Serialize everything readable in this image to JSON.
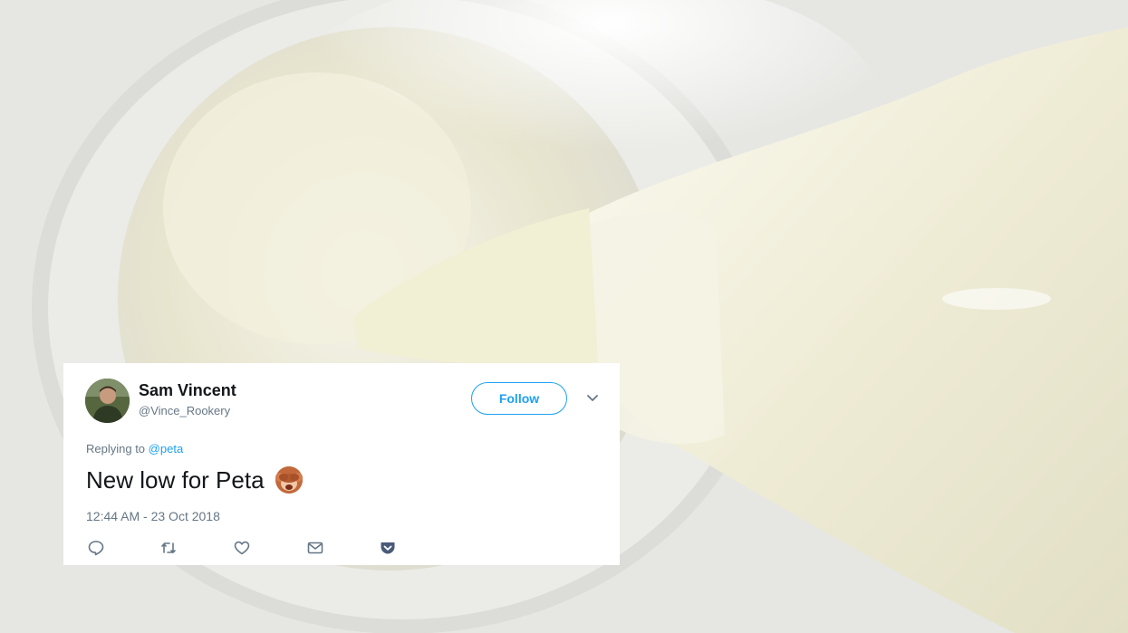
{
  "tweet": {
    "author_name": "Sam Vincent",
    "author_handle": "@Vince_Rookery",
    "follow_label": "Follow",
    "replying_prefix": "Replying to",
    "replying_to": "@peta",
    "text": "New low for Peta",
    "emoji": "see-no-evil-monkey-emoji",
    "timestamp": "12:44 AM - 23 Oct 2018",
    "actions": [
      "reply-icon",
      "retweet-icon",
      "like-icon",
      "direct-message-icon",
      "pocket-icon"
    ]
  },
  "colors": {
    "accent": "#1da1f2",
    "secondary_text": "#657786",
    "primary_text": "#14171a"
  }
}
